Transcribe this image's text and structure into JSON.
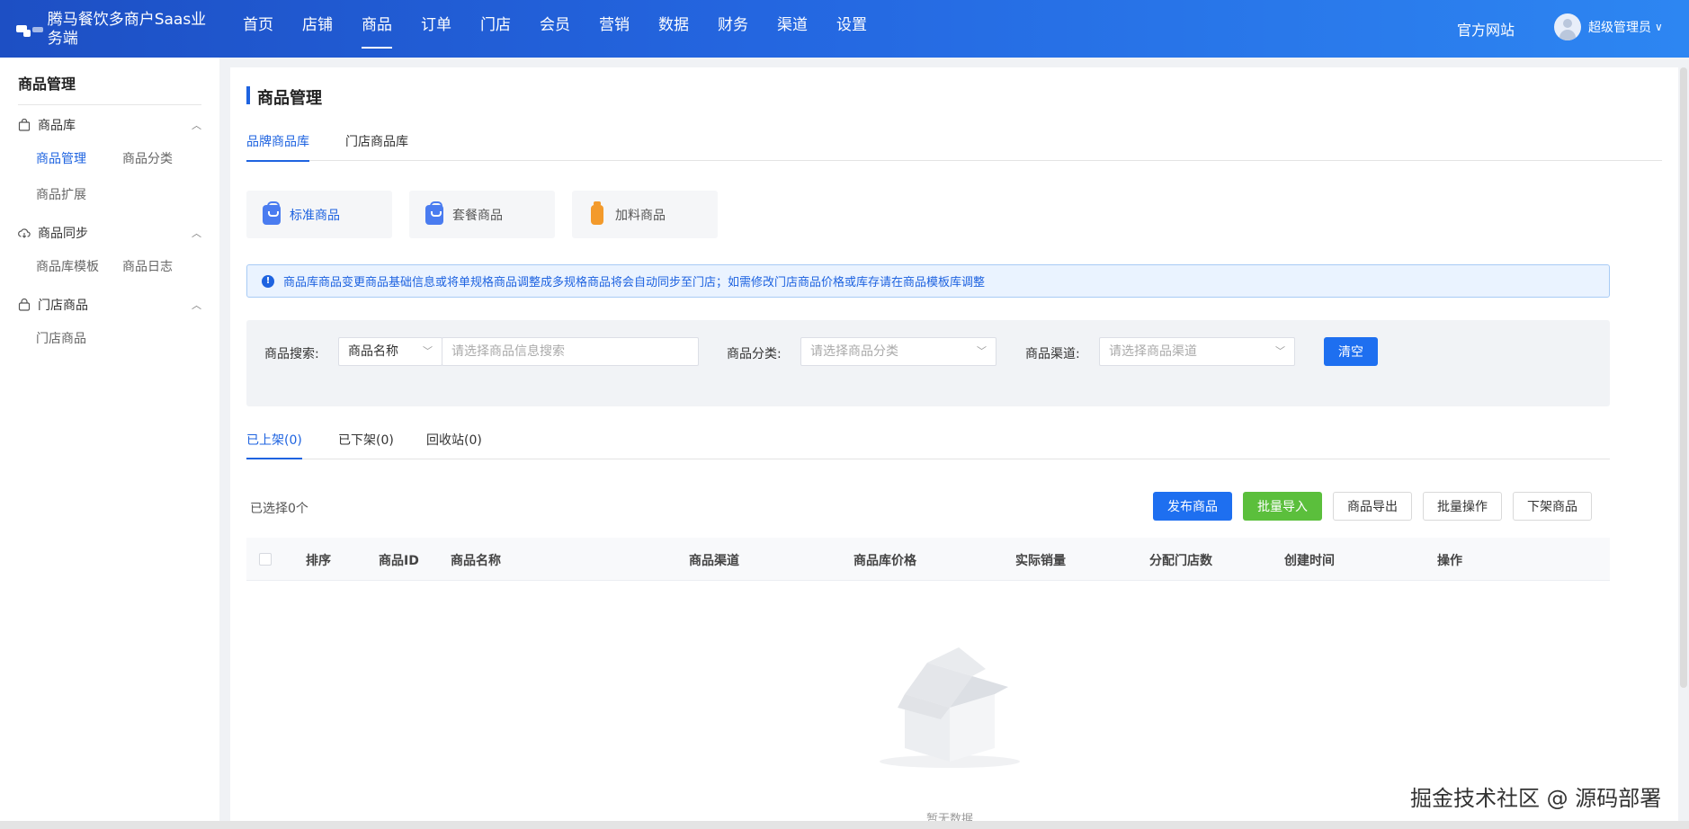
{
  "header": {
    "brand_title": "腾马餐饮多商户Saas业务端",
    "nav": [
      "首页",
      "店铺",
      "商品",
      "订单",
      "门店",
      "会员",
      "营销",
      "数据",
      "财务",
      "渠道",
      "设置"
    ],
    "active_nav": "商品",
    "site_link": "官方网站",
    "user_name": "超级管理员",
    "user_caret": "∨"
  },
  "sidebar": {
    "title": "商品管理",
    "groups": [
      {
        "label": "商品库",
        "icon": "shopping-bag-icon",
        "items": [
          "商品管理",
          "商品分类",
          "商品扩展"
        ]
      },
      {
        "label": "商品同步",
        "icon": "cloud-sync-icon",
        "items": [
          "商品库模板",
          "商品日志"
        ]
      },
      {
        "label": "门店商品",
        "icon": "lock-bag-icon",
        "items": [
          "门店商品"
        ]
      }
    ],
    "active_item": "商品管理"
  },
  "main": {
    "page_title": "商品管理",
    "lib_tabs": [
      "品牌商品库",
      "门店商品库"
    ],
    "active_lib_tab": "品牌商品库",
    "type_cards": [
      {
        "label": "标准商品",
        "icon": "blue-bag-icon"
      },
      {
        "label": "套餐商品",
        "icon": "blue-bag-icon"
      },
      {
        "label": "加料商品",
        "icon": "orange-bottle-icon"
      }
    ],
    "alert": "商品库商品变更商品基础信息或将单规格商品调整成多规格商品将会自动同步至门店；如需修改门店商品价格或库存请在商品模板库调整",
    "filter": {
      "search_label": "商品搜索:",
      "search_type": "商品名称",
      "search_placeholder": "请选择商品信息搜索",
      "category_label": "商品分类:",
      "category_placeholder": "请选择商品分类",
      "channel_label": "商品渠道:",
      "channel_placeholder": "请选择商品渠道",
      "clear_button": "清空"
    },
    "status_tabs": [
      "已上架(0)",
      "已下架(0)",
      "回收站(0)"
    ],
    "active_status_tab": "已上架(0)",
    "selected_count": "已选择0个",
    "actions": [
      "发布商品",
      "批量导入",
      "商品导出",
      "批量操作",
      "下架商品"
    ],
    "table_headers": [
      "排序",
      "商品ID",
      "商品名称",
      "商品渠道",
      "商品库价格",
      "实际销量",
      "分配门店数",
      "创建时间",
      "操作"
    ],
    "empty_text": "暂无数据"
  },
  "watermark": "掘金技术社区 @ 源码部署",
  "colors": {
    "primary": "#1e63e0",
    "success": "#5bbf3c",
    "header_start": "#1d4fc4",
    "header_end": "#2d86f2"
  }
}
